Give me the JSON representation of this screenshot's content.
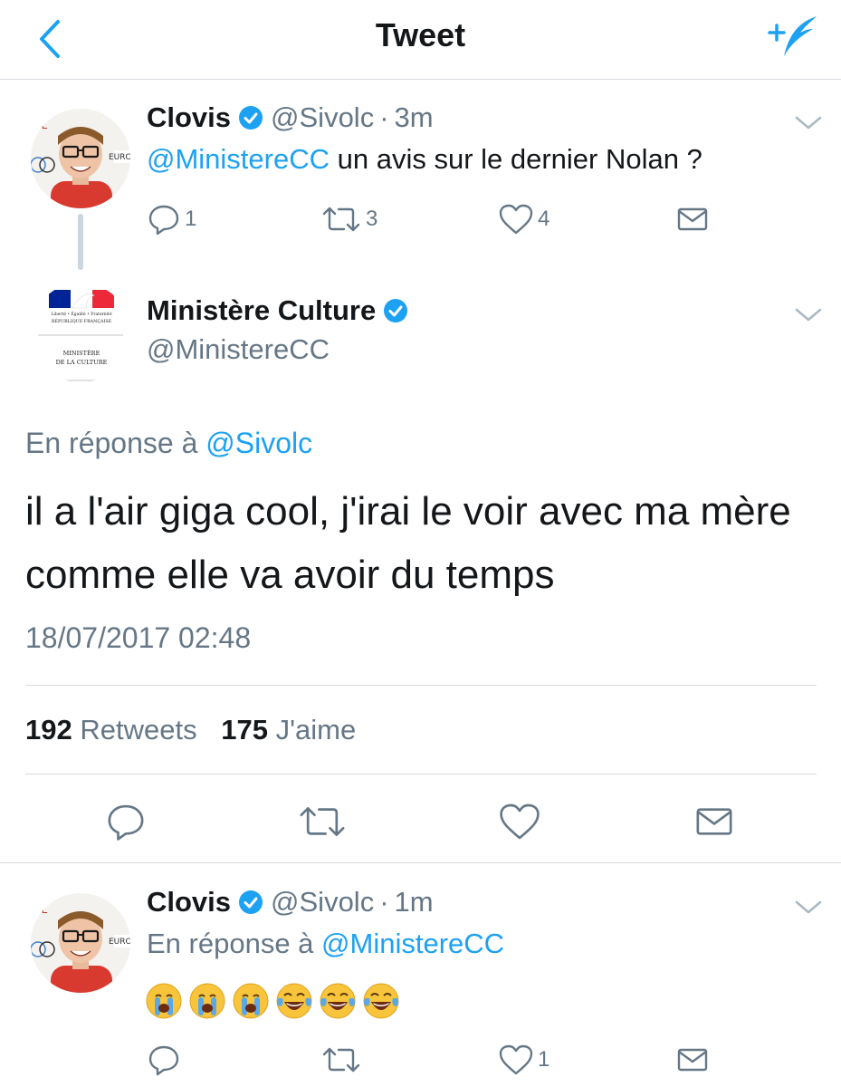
{
  "navbar": {
    "title": "Tweet",
    "back_icon": "chevron-left-icon",
    "compose_icon": "compose-tweet-icon"
  },
  "tweet1": {
    "name": "Clovis",
    "handle": "@Sivolc",
    "time": "3m",
    "mention": "@MinistereCC",
    "text": " un avis sur le dernier Nolan ?",
    "replies": "1",
    "retweets": "3",
    "likes": "4"
  },
  "main_tweet": {
    "name": "Ministère Culture",
    "handle": "@MinistereCC",
    "reply_prefix": "En réponse à ",
    "reply_to": "@Sivolc",
    "text": "il a l'air giga cool, j'irai le voir avec ma mère comme elle va avoir du temps",
    "timestamp": "18/07/2017 02:48",
    "retweet_count": "192",
    "retweet_label": "Retweets",
    "like_count": "175",
    "like_label": "J'aime",
    "logo_text": {
      "motto": "Liberté • Égalité • Fraternité",
      "republic": "RÉPUBLIQUE FRANÇAISE",
      "line1": "MINISTÈRE",
      "line2": "DE LA CULTURE"
    }
  },
  "tweet3": {
    "name": "Clovis",
    "handle": "@Sivolc",
    "time": "1m",
    "reply_prefix": "En réponse à ",
    "reply_to": "@MinistereCC",
    "emojis": [
      "crying-face",
      "crying-face",
      "crying-face",
      "tears-of-joy",
      "tears-of-joy",
      "tears-of-joy"
    ],
    "likes": "1"
  },
  "colors": {
    "accent": "#1da1f2",
    "muted": "#657786",
    "text": "#14171a",
    "border": "#d6dbdf"
  }
}
